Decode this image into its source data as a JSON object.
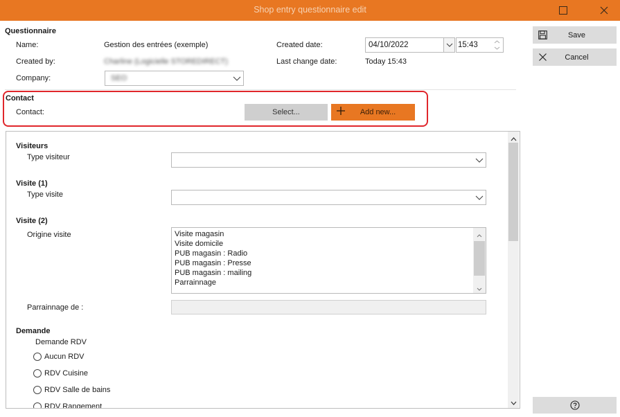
{
  "window": {
    "title": "Shop entry questionnaire edit"
  },
  "questionnaire": {
    "section_title": "Questionnaire",
    "name_label": "Name:",
    "name_value": "Gestion des entrées (exemple)",
    "created_by_label": "Created by:",
    "created_by_value": "Charline (Logicielle STOREDIRECT)",
    "company_label": "Company:",
    "company_value": "SEO",
    "created_date_label": "Created date:",
    "created_date_value": "04/10/2022",
    "created_time_value": "15:43",
    "last_change_label": "Last change date:",
    "last_change_value": "Today 15:43"
  },
  "contact": {
    "section_title": "Contact",
    "contact_label": "Contact:",
    "select_button": "Select...",
    "add_new_button": "Add new..."
  },
  "sidebar": {
    "save_label": "Save",
    "cancel_label": "Cancel"
  },
  "form": {
    "visiteurs": {
      "title": "Visiteurs",
      "field_label": "Type visiteur",
      "value": ""
    },
    "visite1": {
      "title": "Visite (1)",
      "field_label": "Type visite",
      "value": ""
    },
    "visite2": {
      "title": "Visite (2)",
      "field_label": "Origine visite",
      "options": [
        "Visite magasin",
        "Visite domicile",
        "PUB magasin : Radio",
        "PUB magasin : Presse",
        "PUB magasin : mailing",
        "Parrainnage"
      ]
    },
    "parrainnage": {
      "field_label": "Parrainnage de :",
      "value": ""
    },
    "demande": {
      "title": "Demande",
      "subtitle": "Demande RDV",
      "options": [
        "Aucun RDV",
        "RDV Cuisine",
        "RDV Salle de bains",
        "RDV Rangement"
      ]
    }
  },
  "colors": {
    "accent": "#e87722",
    "highlight": "#e0262b",
    "button_gray": "#dcdcdc"
  },
  "icons": {
    "save": "floppy-disk-icon",
    "cancel": "close-icon",
    "help": "help-icon"
  }
}
